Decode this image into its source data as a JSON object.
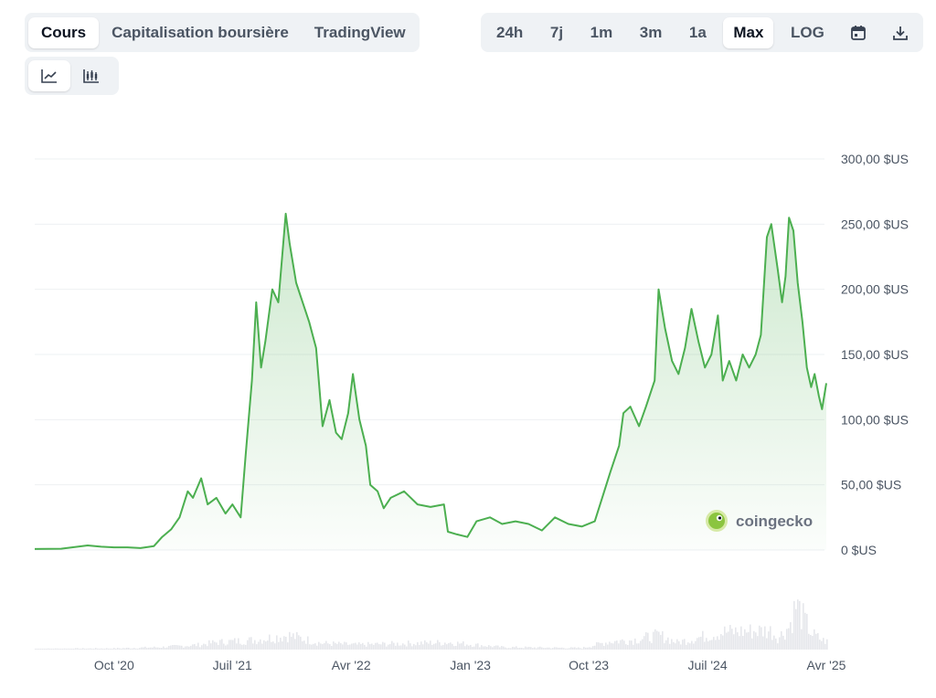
{
  "tabs": [
    {
      "label": "Cours",
      "active": true
    },
    {
      "label": "Capitalisation boursière",
      "active": false
    },
    {
      "label": "TradingView",
      "active": false
    }
  ],
  "ranges": [
    {
      "label": "24h",
      "active": false
    },
    {
      "label": "7j",
      "active": false
    },
    {
      "label": "1m",
      "active": false
    },
    {
      "label": "3m",
      "active": false
    },
    {
      "label": "1a",
      "active": false
    },
    {
      "label": "Max",
      "active": true
    },
    {
      "label": "LOG",
      "active": false
    }
  ],
  "toolbar_icons": [
    "calendar-icon",
    "download-icon"
  ],
  "chart_type_icons": [
    "line-chart-icon",
    "candlestick-chart-icon"
  ],
  "watermark": "coingecko",
  "colors": {
    "line": "#4caf50",
    "accent": "#0d1421"
  },
  "chart_data": {
    "type": "line",
    "title": "",
    "xlabel": "",
    "ylabel": "",
    "x_ticks": [
      "Oct '20",
      "Juil '21",
      "Avr '22",
      "Jan '23",
      "Oct '23",
      "Juil '24",
      "Avr '25"
    ],
    "y_ticks": [
      "0 $US",
      "50,00 $US",
      "100,00 $US",
      "150,00 $US",
      "200,00 $US",
      "250,00 $US",
      "300,00 $US"
    ],
    "ylim": [
      0,
      300
    ],
    "xlim": [
      "2020-04-01",
      "2025-04-01"
    ],
    "grid": true,
    "legend": "none",
    "series": [
      {
        "values": [
          [
            "2020-04-01",
            0.8
          ],
          [
            "2020-06-01",
            1.0
          ],
          [
            "2020-08-01",
            3.5
          ],
          [
            "2020-09-01",
            2.5
          ],
          [
            "2020-10-01",
            2.0
          ],
          [
            "2020-11-01",
            2.0
          ],
          [
            "2020-12-01",
            1.5
          ],
          [
            "2021-01-01",
            3.0
          ],
          [
            "2021-01-20",
            10
          ],
          [
            "2021-02-10",
            16
          ],
          [
            "2021-03-01",
            25
          ],
          [
            "2021-03-20",
            45
          ],
          [
            "2021-04-01",
            40
          ],
          [
            "2021-04-20",
            55
          ],
          [
            "2021-05-05",
            35
          ],
          [
            "2021-05-25",
            40
          ],
          [
            "2021-06-15",
            28
          ],
          [
            "2021-07-01",
            35
          ],
          [
            "2021-07-20",
            25
          ],
          [
            "2021-08-01",
            75
          ],
          [
            "2021-08-15",
            130
          ],
          [
            "2021-08-25",
            190
          ],
          [
            "2021-09-05",
            140
          ],
          [
            "2021-09-15",
            160
          ],
          [
            "2021-10-01",
            200
          ],
          [
            "2021-10-15",
            190
          ],
          [
            "2021-11-01",
            258
          ],
          [
            "2021-11-10",
            235
          ],
          [
            "2021-11-25",
            205
          ],
          [
            "2021-12-10",
            190
          ],
          [
            "2021-12-25",
            175
          ],
          [
            "2022-01-10",
            155
          ],
          [
            "2022-01-25",
            95
          ],
          [
            "2022-02-10",
            115
          ],
          [
            "2022-02-25",
            90
          ],
          [
            "2022-03-10",
            85
          ],
          [
            "2022-03-25",
            105
          ],
          [
            "2022-04-05",
            135
          ],
          [
            "2022-04-20",
            100
          ],
          [
            "2022-05-05",
            80
          ],
          [
            "2022-05-15",
            50
          ],
          [
            "2022-06-01",
            45
          ],
          [
            "2022-06-15",
            32
          ],
          [
            "2022-07-01",
            40
          ],
          [
            "2022-08-01",
            45
          ],
          [
            "2022-09-01",
            35
          ],
          [
            "2022-10-01",
            33
          ],
          [
            "2022-11-01",
            35
          ],
          [
            "2022-11-10",
            14
          ],
          [
            "2022-12-01",
            12
          ],
          [
            "2022-12-25",
            10
          ],
          [
            "2023-01-15",
            22
          ],
          [
            "2023-02-15",
            25
          ],
          [
            "2023-03-15",
            20
          ],
          [
            "2023-04-15",
            22
          ],
          [
            "2023-05-15",
            20
          ],
          [
            "2023-06-15",
            15
          ],
          [
            "2023-07-15",
            25
          ],
          [
            "2023-08-15",
            20
          ],
          [
            "2023-09-15",
            18
          ],
          [
            "2023-10-15",
            22
          ],
          [
            "2023-11-01",
            40
          ],
          [
            "2023-11-20",
            60
          ],
          [
            "2023-12-10",
            80
          ],
          [
            "2023-12-20",
            105
          ],
          [
            "2024-01-05",
            110
          ],
          [
            "2024-01-25",
            95
          ],
          [
            "2024-02-10",
            110
          ],
          [
            "2024-03-01",
            130
          ],
          [
            "2024-03-10",
            200
          ],
          [
            "2024-03-25",
            170
          ],
          [
            "2024-04-10",
            145
          ],
          [
            "2024-04-25",
            135
          ],
          [
            "2024-05-10",
            155
          ],
          [
            "2024-05-25",
            185
          ],
          [
            "2024-06-10",
            160
          ],
          [
            "2024-06-25",
            140
          ],
          [
            "2024-07-10",
            150
          ],
          [
            "2024-07-25",
            180
          ],
          [
            "2024-08-05",
            130
          ],
          [
            "2024-08-20",
            145
          ],
          [
            "2024-09-05",
            130
          ],
          [
            "2024-09-20",
            150
          ],
          [
            "2024-10-05",
            140
          ],
          [
            "2024-10-20",
            150
          ],
          [
            "2024-11-01",
            165
          ],
          [
            "2024-11-15",
            240
          ],
          [
            "2024-11-25",
            250
          ],
          [
            "2024-12-10",
            215
          ],
          [
            "2024-12-20",
            190
          ],
          [
            "2024-12-28",
            210
          ],
          [
            "2025-01-05",
            255
          ],
          [
            "2025-01-15",
            245
          ],
          [
            "2025-01-25",
            205
          ],
          [
            "2025-02-05",
            175
          ],
          [
            "2025-02-15",
            140
          ],
          [
            "2025-02-25",
            125
          ],
          [
            "2025-03-05",
            135
          ],
          [
            "2025-03-15",
            118
          ],
          [
            "2025-03-22",
            108
          ],
          [
            "2025-04-01",
            128
          ]
        ]
      }
    ],
    "volume": [
      [
        "2020-04-01",
        1
      ],
      [
        "2020-10-01",
        1.5
      ],
      [
        "2021-01-15",
        3
      ],
      [
        "2021-04-15",
        6
      ],
      [
        "2021-05-20",
        9
      ],
      [
        "2021-08-20",
        12
      ],
      [
        "2021-11-05",
        18
      ],
      [
        "2022-01-20",
        8
      ],
      [
        "2022-04-10",
        6
      ],
      [
        "2022-06-15",
        7
      ],
      [
        "2022-11-10",
        9
      ],
      [
        "2023-03-15",
        3
      ],
      [
        "2023-09-15",
        2
      ],
      [
        "2023-11-15",
        10
      ],
      [
        "2024-01-10",
        12
      ],
      [
        "2024-03-10",
        18
      ],
      [
        "2024-04-20",
        9
      ],
      [
        "2024-08-05",
        22
      ],
      [
        "2024-11-20",
        24
      ],
      [
        "2024-12-10",
        15
      ],
      [
        "2025-01-05",
        30
      ],
      [
        "2025-01-20",
        56
      ],
      [
        "2025-02-25",
        20
      ],
      [
        "2025-03-20",
        12
      ],
      [
        "2025-04-01",
        10
      ]
    ]
  }
}
